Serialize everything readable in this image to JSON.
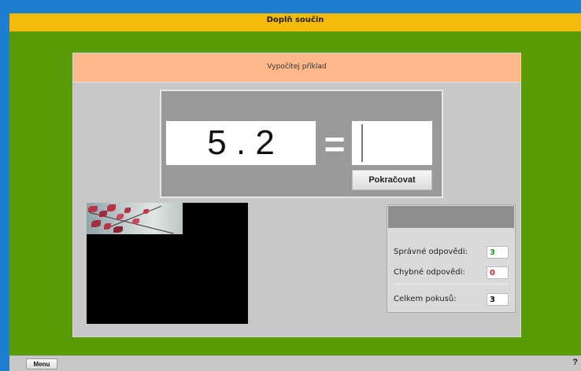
{
  "app": {
    "title": "Doplň součin"
  },
  "panel": {
    "title": "Vypočítej příklad"
  },
  "problem": {
    "expression": "5 . 2",
    "equals": "=",
    "answer_value": "",
    "continue_label": "Pokračovat"
  },
  "stats": {
    "correct_label": "Správné odpovědi:",
    "correct_value": "3",
    "correct_color": "#1f9a1f",
    "wrong_label": "Chybné odpovědi:",
    "wrong_value": "0",
    "wrong_color": "#e02020",
    "total_label": "Celkem pokusů:",
    "total_value": "3",
    "total_color": "#111111"
  },
  "bottom": {
    "menu_label": "Menu",
    "help_label": "?"
  },
  "colors": {
    "title_bar": "#f5bb0a",
    "work_area": "#5a9c08",
    "panel_header": "#fdb78a",
    "panel_bg": "#c8c8c8",
    "problem_bg": "#9a9a9a"
  },
  "picture": {
    "revealed_fraction": 0.15
  }
}
